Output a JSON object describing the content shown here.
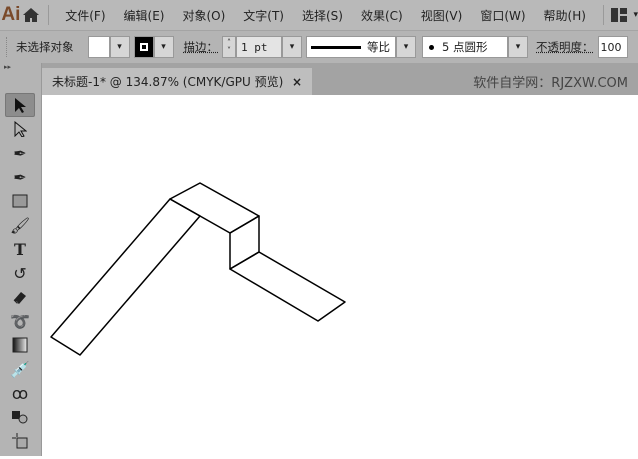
{
  "app": {
    "logo": "Ai"
  },
  "menu": [
    "文件(F)",
    "编辑(E)",
    "对象(O)",
    "文字(T)",
    "选择(S)",
    "效果(C)",
    "视图(V)",
    "窗口(W)",
    "帮助(H)"
  ],
  "control": {
    "selection": "未选择对象",
    "stroke_label": "描边：",
    "stroke_value": "1 pt",
    "profile": "等比",
    "brush": "5 点圆形",
    "opacity_label": "不透明度：",
    "opacity_value": "100"
  },
  "document": {
    "tab_title": "未标题-1* @ 134.87% (CMYK/GPU 预览)",
    "close": "×",
    "watermark": "软件自学网：RJZXW.COM"
  },
  "tools": [
    "selection-tool",
    "direct-selection-tool",
    "pen-tool",
    "curvature-tool",
    "rectangle-tool",
    "paintbrush-tool",
    "type-tool",
    "rotate-tool",
    "eraser-tool",
    "lasso-tool",
    "gradient-tool",
    "eyedropper-tool",
    "puppet-warp-tool",
    "shape-builder-tool",
    "artboard-tool"
  ]
}
